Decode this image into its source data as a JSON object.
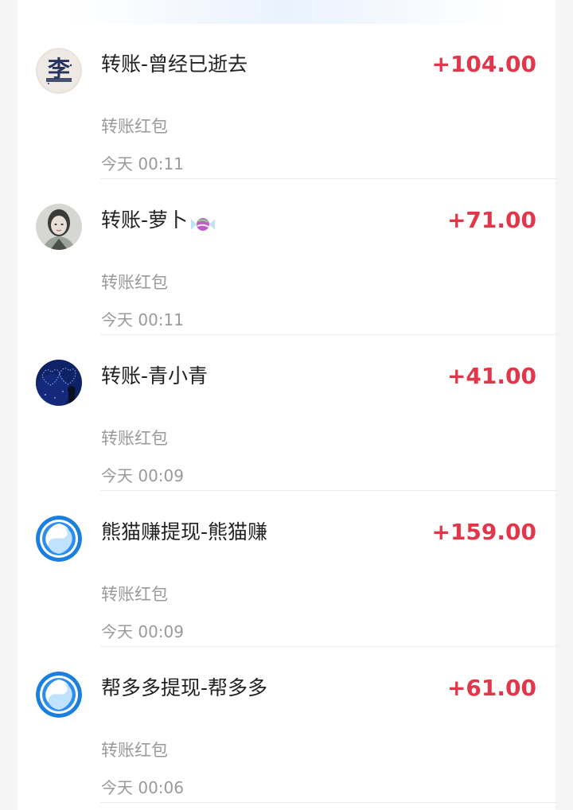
{
  "transactions": [
    {
      "avatar_icon": "li-character-avatar",
      "title": "转账-曾经已逝去",
      "amount": "+104.00",
      "subtitle": "转账红包",
      "time": "今天 00:11"
    },
    {
      "avatar_icon": "girl-photo-avatar",
      "title": "转账-萝卜",
      "title_emoji": "candy-emoji",
      "amount": "+71.00",
      "subtitle": "转账红包",
      "time": "今天 00:11"
    },
    {
      "avatar_icon": "night-sky-avatar",
      "title": "转账-青小青",
      "amount": "+41.00",
      "subtitle": "转账红包",
      "time": "今天 00:09"
    },
    {
      "avatar_icon": "blue-swirl-logo-avatar",
      "title": "熊猫赚提现-熊猫赚",
      "amount": "+159.00",
      "subtitle": "转账红包",
      "time": "今天 00:09"
    },
    {
      "avatar_icon": "blue-swirl-logo-avatar",
      "title": "帮多多提现-帮多多",
      "amount": "+61.00",
      "subtitle": "转账红包",
      "time": "今天 00:06"
    }
  ],
  "colors": {
    "amount": "#e2364a",
    "title": "#222222",
    "secondary_text": "#9a9a9a",
    "background": "#f5f5f5",
    "card": "#ffffff"
  }
}
